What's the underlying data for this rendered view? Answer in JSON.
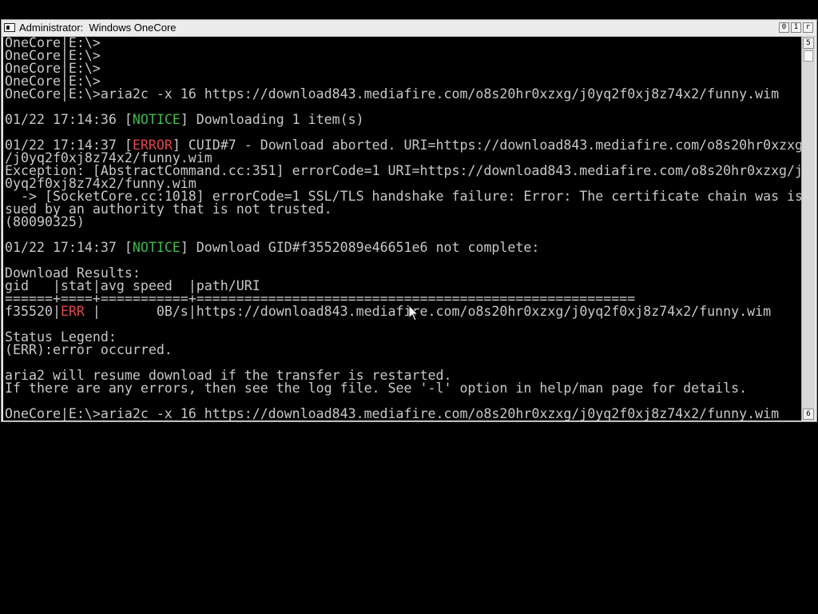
{
  "window": {
    "title": "Administrator:  Windows OneCore",
    "buttons": {
      "minimize": "0",
      "maximize": "1",
      "close": "r"
    }
  },
  "scrollbar": {
    "up_glyph": "5",
    "down_glyph": "6"
  },
  "console": {
    "lines": [
      [
        {
          "text": "OneCore|E:\\>"
        }
      ],
      [
        {
          "text": "OneCore|E:\\>"
        }
      ],
      [
        {
          "text": "OneCore|E:\\>"
        }
      ],
      [
        {
          "text": "OneCore|E:\\>"
        }
      ],
      [
        {
          "text": "OneCore|E:\\>aria2c -x 16 https://download843.mediafire.com/o8s20hr0xzxg/j0yq2f0xj8z74x2/funny.wim"
        }
      ],
      [
        {
          "text": ""
        }
      ],
      [
        {
          "text": "01/22 17:14:36 ["
        },
        {
          "text": "NOTICE",
          "style": "notice"
        },
        {
          "text": "] Downloading 1 item(s)"
        }
      ],
      [
        {
          "text": ""
        }
      ],
      [
        {
          "text": "01/22 17:14:37 ["
        },
        {
          "text": "ERROR",
          "style": "err"
        },
        {
          "text": "] CUID#7 - Download aborted. URI=https://download843.mediafire.com/o8s20hr0xzxg"
        }
      ],
      [
        {
          "text": "/j0yq2f0xj8z74x2/funny.wim"
        }
      ],
      [
        {
          "text": "Exception: [AbstractCommand.cc:351] errorCode=1 URI=https://download843.mediafire.com/o8s20hr0xzxg/j"
        }
      ],
      [
        {
          "text": "0yq2f0xj8z74x2/funny.wim"
        }
      ],
      [
        {
          "text": "  -> [SocketCore.cc:1018] errorCode=1 SSL/TLS handshake failure: Error: The certificate chain was is"
        }
      ],
      [
        {
          "text": "sued by an authority that is not trusted."
        }
      ],
      [
        {
          "text": "(80090325)"
        }
      ],
      [
        {
          "text": ""
        }
      ],
      [
        {
          "text": "01/22 17:14:37 ["
        },
        {
          "text": "NOTICE",
          "style": "notice"
        },
        {
          "text": "] Download GID#f3552089e46651e6 not complete:"
        }
      ],
      [
        {
          "text": ""
        }
      ],
      [
        {
          "text": "Download Results:"
        }
      ],
      [
        {
          "text": "gid   |stat|avg speed  |path/URI"
        }
      ],
      [
        {
          "text": "======+====+===========+======================================================="
        }
      ],
      [
        {
          "text": "f35520|"
        },
        {
          "text": "ERR",
          "style": "err"
        },
        {
          "text": " |       0B/s|https://download843.mediafire.com/o8s20hr0xzxg/j0yq2f0xj8z74x2/funny.wim"
        }
      ],
      [
        {
          "text": ""
        }
      ],
      [
        {
          "text": "Status Legend:"
        }
      ],
      [
        {
          "text": "(ERR):error occurred."
        }
      ],
      [
        {
          "text": ""
        }
      ],
      [
        {
          "text": "aria2 will resume download if the transfer is restarted."
        }
      ],
      [
        {
          "text": "If there are any errors, then see the log file. See '-l' option in help/man page for details."
        }
      ],
      [
        {
          "text": ""
        }
      ],
      [
        {
          "text": "OneCore|E:\\>aria2c -x 16 https://download843.mediafire.com/o8s20hr0xzxg/j0yq2f0xj8z74x2/funny.wim"
        }
      ]
    ]
  }
}
